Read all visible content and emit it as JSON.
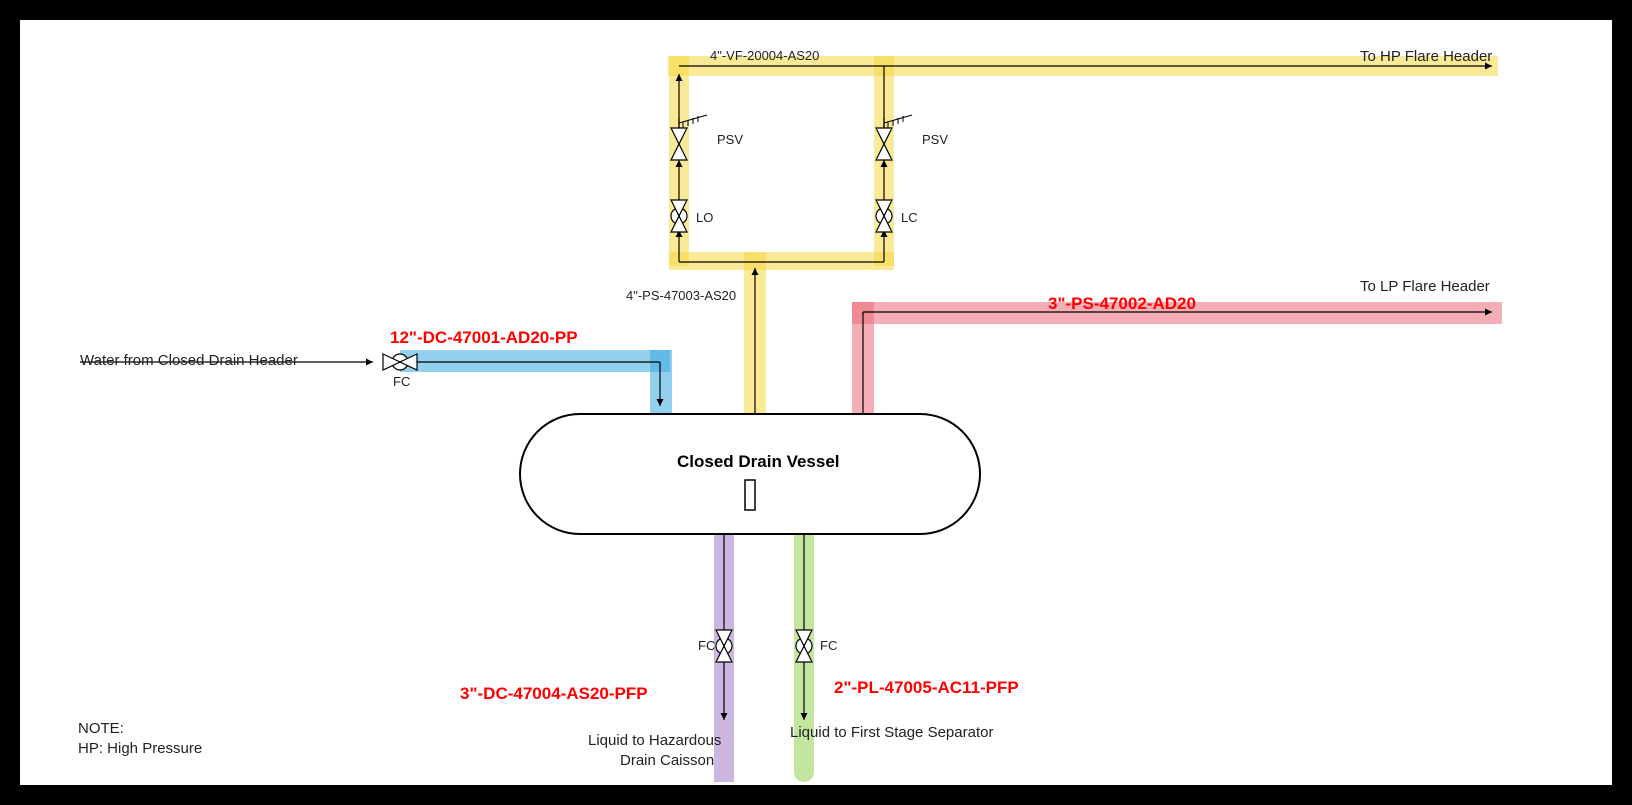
{
  "vessel": {
    "name": "Closed Drain Vessel"
  },
  "streams": {
    "inlet_water": {
      "text": "Water from Closed Drain Header",
      "line_id": "12\"-DC-47001-AD20-PP",
      "valve": "FC"
    },
    "hp_flare": {
      "text": "To HP Flare Header",
      "line_id": "4\"-VF-20004-AS20"
    },
    "lp_flare": {
      "text": "To LP Flare Header",
      "line_id": "3\"-PS-47002-AD20"
    },
    "ps_riser": {
      "line_id": "4\"-PS-47003-AS20"
    },
    "haz_drain": {
      "text": "Liquid to Hazardous\nDrain Caisson",
      "line_id": "3\"-DC-47004-AS20-PFP",
      "valve": "FC"
    },
    "separator": {
      "text": "Liquid to First Stage Separator",
      "line_id": "2\"-PL-47005-AC11-PFP",
      "valve": "FC"
    }
  },
  "valves": {
    "psv_left": "PSV",
    "psv_right": "PSV",
    "lo": "LO",
    "lc": "LC"
  },
  "note": {
    "line1": "NOTE:",
    "line2": "HP: High Pressure"
  },
  "haz_drain_line1": "Liquid to Hazardous",
  "haz_drain_line2": "Drain Caisson"
}
